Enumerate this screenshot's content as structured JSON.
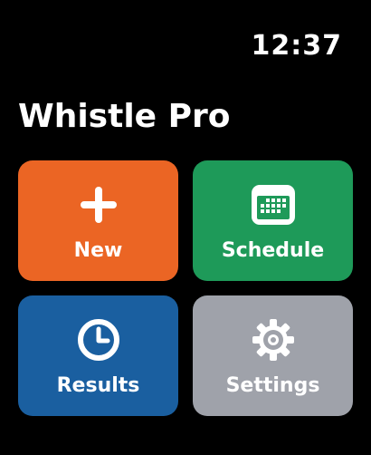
{
  "status": {
    "time": "12:37"
  },
  "app": {
    "title": "Whistle Pro"
  },
  "tiles": [
    {
      "label": "New",
      "icon": "plus-icon",
      "color": "#EB6524"
    },
    {
      "label": "Schedule",
      "icon": "calendar-icon",
      "color": "#1E9A59"
    },
    {
      "label": "Results",
      "icon": "clock-icon",
      "color": "#1A5FA0"
    },
    {
      "label": "Settings",
      "icon": "gear-icon",
      "color": "#9FA2AA"
    }
  ]
}
